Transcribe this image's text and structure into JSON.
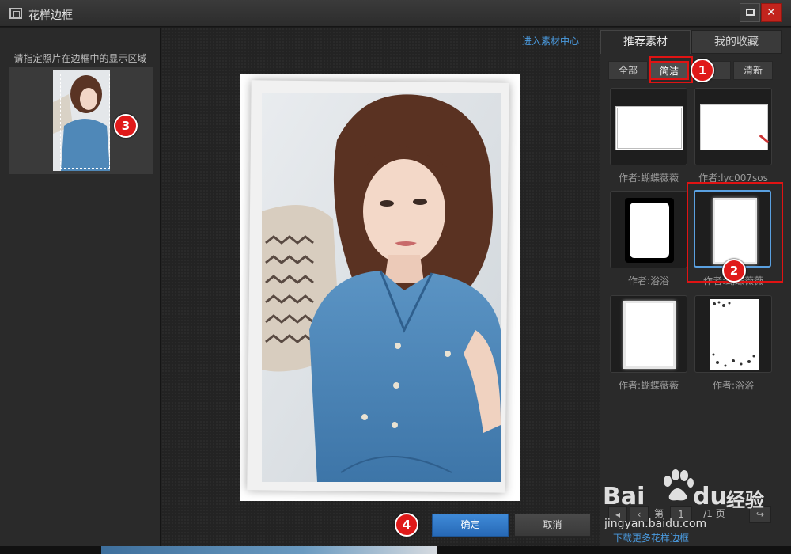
{
  "window": {
    "title": "花样边框"
  },
  "left_panel": {
    "caption": "请指定照片在边框中的显示区域"
  },
  "canvas": {
    "material_center_link": "进入素材中心",
    "ok_label": "确定",
    "cancel_label": "取消"
  },
  "right_panel": {
    "tabs": [
      "推荐素材",
      "我的收藏"
    ],
    "categories": [
      "全部",
      "简洁",
      "",
      "清新"
    ],
    "selected_category": "简洁",
    "tiles": [
      {
        "author": "作者:蝴蝶薇薇"
      },
      {
        "author": "作者:lyc007sos"
      },
      {
        "author": "作者:浴浴"
      },
      {
        "author": "作者:蝴蝶薇薇"
      },
      {
        "author": "作者:蝴蝶薇薇"
      },
      {
        "author": "作者:浴浴"
      }
    ],
    "pager": {
      "prefix": "第",
      "current": "1",
      "total": "/1 页"
    },
    "more_link": "下载更多花样边框"
  },
  "annotations": [
    "1",
    "2",
    "3",
    "4"
  ],
  "watermark": {
    "brand": "Bai",
    "brand2": "du",
    "cn": "经验",
    "url": "jingyan.baidu.com"
  },
  "colors": {
    "accent_blue": "#2f7bd0",
    "annotation_red": "#e01313",
    "link_blue": "#4a9be0"
  }
}
